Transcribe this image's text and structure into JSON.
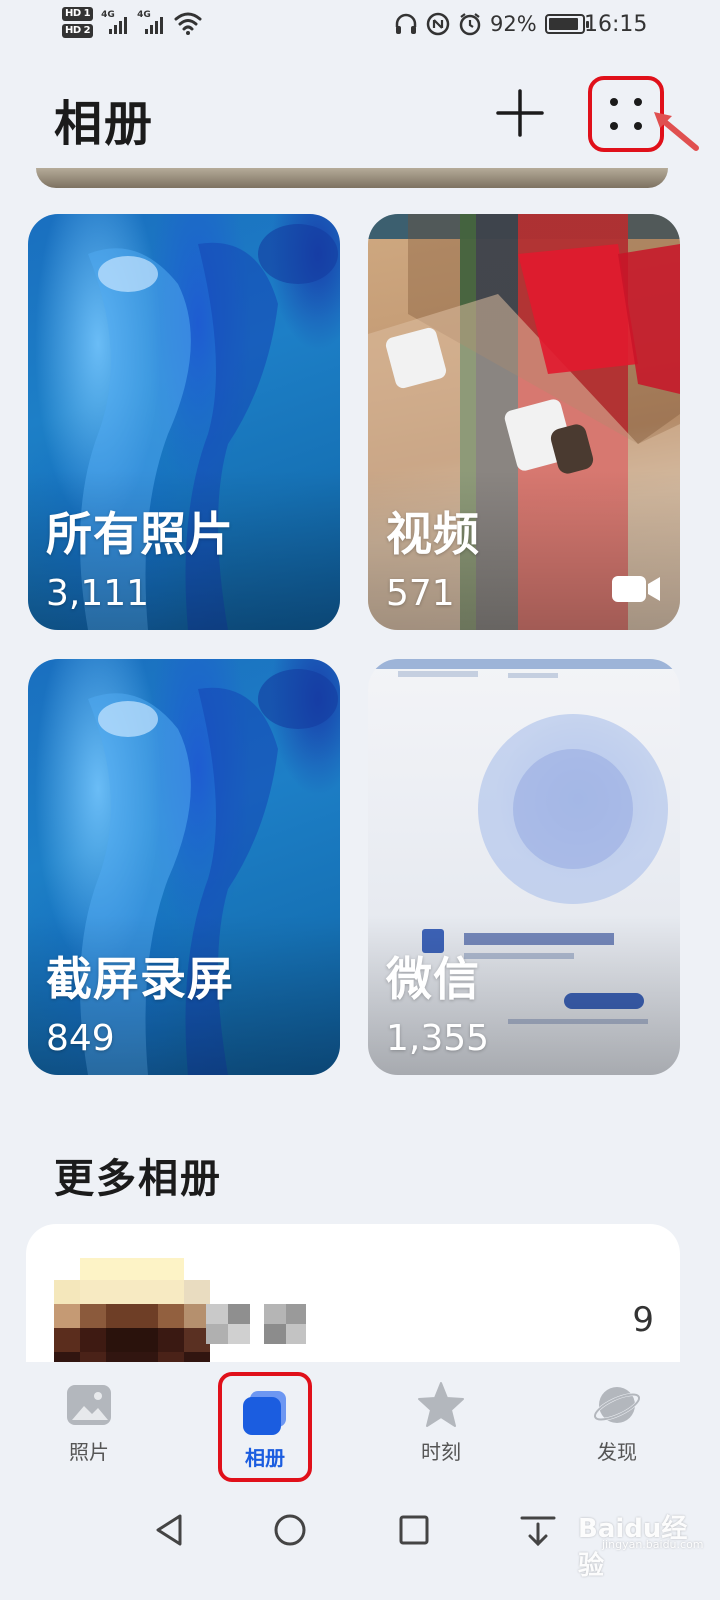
{
  "status_bar": {
    "hd1": "HD 1",
    "hd2": "HD 2",
    "net1": "4G",
    "net2": "4G",
    "battery_percent": "92%",
    "battery_level": 0.92,
    "time": "16:15",
    "icons": [
      "headphones-icon",
      "nfc-icon",
      "alarm-icon",
      "wifi-icon",
      "battery-icon"
    ]
  },
  "header": {
    "title": "相册",
    "add_icon": "plus-icon",
    "more_icon": "grid-dots-icon"
  },
  "albums": [
    {
      "title": "所有照片",
      "count": "3,111",
      "cover": "blue-wallpaper"
    },
    {
      "title": "视频",
      "count": "571",
      "cover": "box-photo",
      "badge_icon": "video-camera-icon"
    },
    {
      "title": "截屏录屏",
      "count": "849",
      "cover": "blue-wallpaper"
    },
    {
      "title": "微信",
      "count": "1,355",
      "cover": "document-screenshot"
    }
  ],
  "more_albums": {
    "title": "更多相册",
    "items": [
      {
        "count": "9",
        "thumb": "pixelated-thumbnail",
        "name": "pixelated-name"
      }
    ]
  },
  "bottom_nav": {
    "items": [
      {
        "label": "照片",
        "icon": "photo-icon",
        "active": false
      },
      {
        "label": "相册",
        "icon": "albums-icon",
        "active": true
      },
      {
        "label": "时刻",
        "icon": "star-icon",
        "active": false
      },
      {
        "label": "发现",
        "icon": "planet-icon",
        "active": false
      }
    ],
    "active_color": "#1b5de0"
  },
  "system_nav": [
    "back-icon",
    "home-icon",
    "recents-icon",
    "down-arrow-icon"
  ],
  "watermark": {
    "text": "Baidu经验",
    "sub": "jingyan.baidu.com"
  },
  "colors": {
    "background": "#eef1f6",
    "annotation_red": "#e0101a",
    "accent_blue": "#1b5de0"
  }
}
